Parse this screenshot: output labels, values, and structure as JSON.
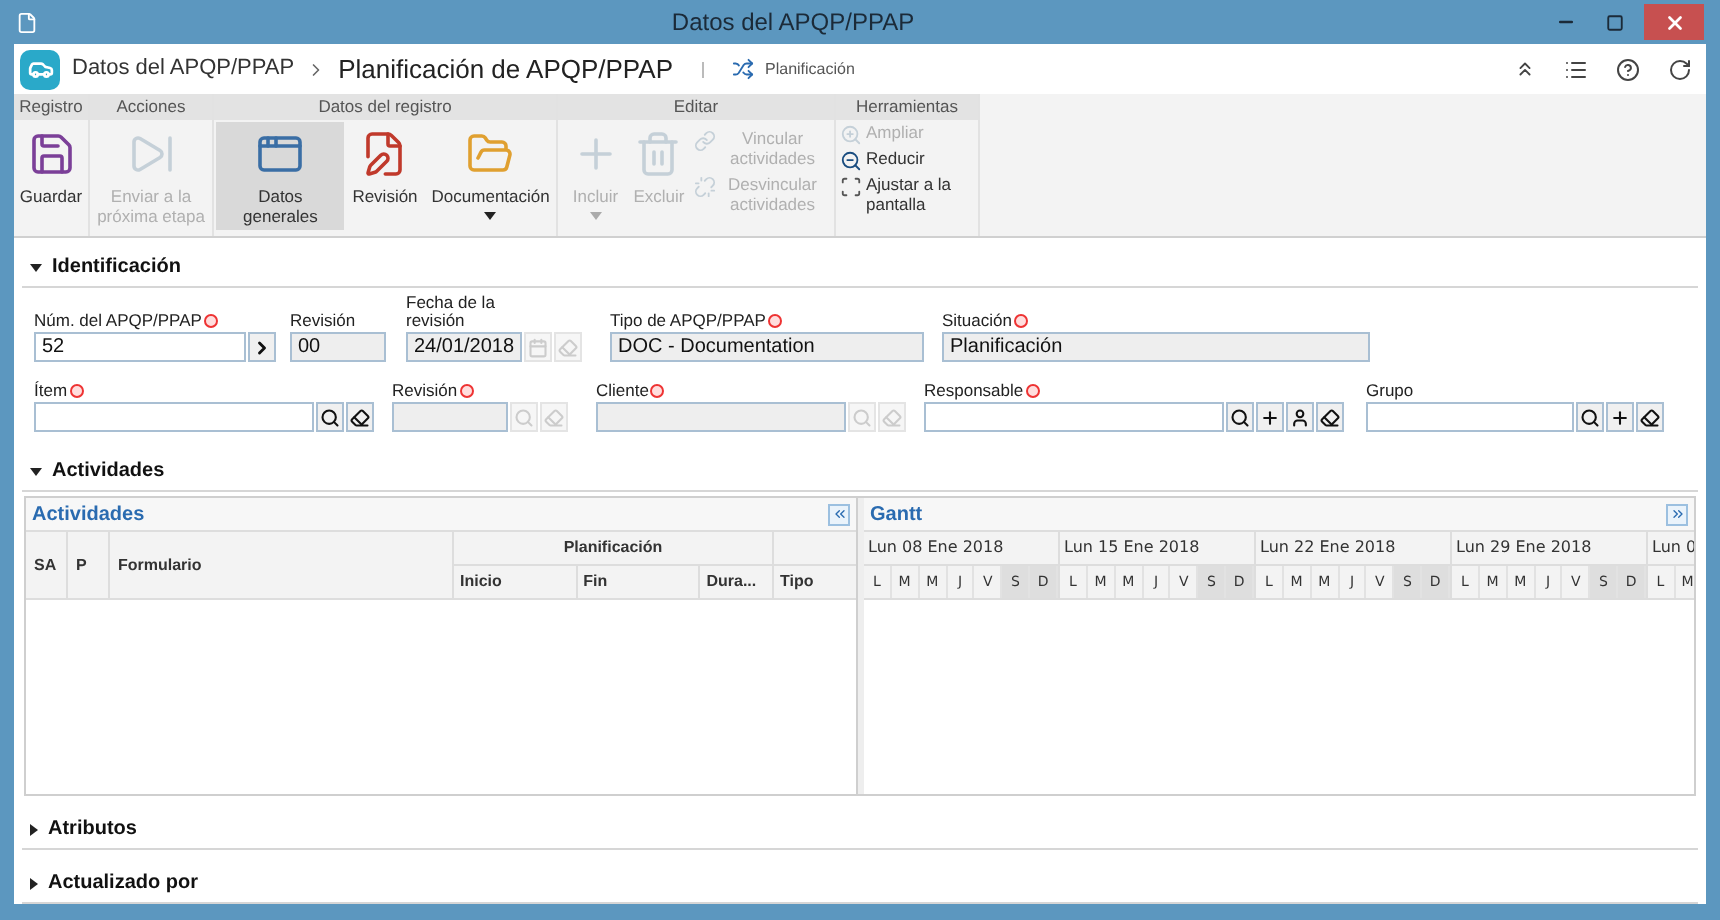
{
  "window": {
    "title": "Datos del APQP/PPAP"
  },
  "header": {
    "breadcrumb": "Datos del APQP/PPAP",
    "title": "Planificación de APQP/PPAP",
    "stage": "Planificación"
  },
  "ribbon": [
    {
      "label": "Registro",
      "items": [
        {
          "kind": "large",
          "label": "Guardar",
          "disabled": false,
          "selected": false,
          "dropdown": false
        }
      ]
    },
    {
      "label": "Acciones",
      "items": [
        {
          "kind": "large",
          "label": "Enviar a la próxima etapa",
          "disabled": true,
          "selected": false,
          "dropdown": false
        }
      ]
    },
    {
      "label": "Datos del registro",
      "items": [
        {
          "kind": "large",
          "label": "Datos generales",
          "disabled": false,
          "selected": true,
          "dropdown": false
        },
        {
          "kind": "large",
          "label": "Revisión",
          "disabled": false,
          "selected": false,
          "dropdown": false
        },
        {
          "kind": "large",
          "label": "Documentación",
          "disabled": false,
          "selected": false,
          "dropdown": true
        }
      ]
    },
    {
      "label": "Editar",
      "items": [
        {
          "kind": "large",
          "label": "Incluir",
          "disabled": true,
          "selected": false,
          "dropdown": true
        },
        {
          "kind": "large",
          "label": "Excluir",
          "disabled": true,
          "selected": false,
          "dropdown": false
        },
        {
          "kind": "small",
          "label": "Vincular actividades",
          "disabled": true,
          "selected": false,
          "dropdown": false
        },
        {
          "kind": "small",
          "label": "Desvincular actividades",
          "disabled": true,
          "selected": false,
          "dropdown": false
        }
      ]
    },
    {
      "label": "Herramientas",
      "items": [
        {
          "kind": "tiny",
          "label": "Ampliar",
          "disabled": true,
          "selected": false,
          "dropdown": false
        },
        {
          "kind": "tiny",
          "label": "Reducir",
          "disabled": false,
          "selected": false,
          "dropdown": false
        },
        {
          "kind": "tiny",
          "label": "Ajustar a la pantalla",
          "disabled": false,
          "selected": false,
          "dropdown": false
        }
      ]
    }
  ],
  "identification": {
    "title": "Identificación",
    "expanded": true,
    "fields": [
      {
        "label": "Núm. del APQP/PPAP",
        "required": true,
        "value": "52",
        "disabled": false
      },
      {
        "label": "Revisión",
        "required": false,
        "value": "00",
        "disabled": true
      },
      {
        "label": "Fecha de la revisión",
        "required": false,
        "value": "24/01/2018",
        "disabled": true
      },
      {
        "label": "Tipo de APQP/PPAP",
        "required": true,
        "value": "DOC - Documentation",
        "disabled": true
      },
      {
        "label": "Situación",
        "required": true,
        "value": "Planificación",
        "disabled": true
      },
      {
        "label": "Ítem",
        "required": true,
        "disabled": false
      },
      {
        "label": "Revisión",
        "required": true,
        "disabled": true
      },
      {
        "label": "Cliente",
        "required": true,
        "disabled": true
      },
      {
        "label": "Responsable",
        "required": true,
        "disabled": false
      },
      {
        "label": "Grupo",
        "required": false,
        "disabled": false
      }
    ]
  },
  "activities": {
    "title": "Actividades",
    "expanded": true,
    "grid": {
      "title": "Actividades",
      "columns": [
        "SA",
        "P",
        "Formulario"
      ],
      "group": "Planificación",
      "subcolumns": [
        "Inicio",
        "Fin",
        "Dura..."
      ],
      "last_column": "Tipo"
    },
    "gantt": {
      "title": "Gantt",
      "weeks": [
        {
          "label": "Lun 08 Ene 2018",
          "days": [
            {
              "label": "L",
              "weekend": false
            },
            {
              "label": "M",
              "weekend": false
            },
            {
              "label": "M",
              "weekend": false
            },
            {
              "label": "J",
              "weekend": false
            },
            {
              "label": "V",
              "weekend": false
            },
            {
              "label": "S",
              "weekend": true
            },
            {
              "label": "D",
              "weekend": true
            }
          ]
        },
        {
          "label": "Lun 15 Ene 2018",
          "days": [
            {
              "label": "L",
              "weekend": false
            },
            {
              "label": "M",
              "weekend": false
            },
            {
              "label": "M",
              "weekend": false
            },
            {
              "label": "J",
              "weekend": false
            },
            {
              "label": "V",
              "weekend": false
            },
            {
              "label": "S",
              "weekend": true
            },
            {
              "label": "D",
              "weekend": true
            }
          ]
        },
        {
          "label": "Lun 22 Ene 2018",
          "days": [
            {
              "label": "L",
              "weekend": false
            },
            {
              "label": "M",
              "weekend": false
            },
            {
              "label": "M",
              "weekend": false
            },
            {
              "label": "J",
              "weekend": false
            },
            {
              "label": "V",
              "weekend": false
            },
            {
              "label": "S",
              "weekend": true
            },
            {
              "label": "D",
              "weekend": true
            }
          ]
        },
        {
          "label": "Lun 29 Ene 2018",
          "days": [
            {
              "label": "L",
              "weekend": false
            },
            {
              "label": "M",
              "weekend": false
            },
            {
              "label": "M",
              "weekend": false
            },
            {
              "label": "J",
              "weekend": false
            },
            {
              "label": "V",
              "weekend": false
            },
            {
              "label": "S",
              "weekend": true
            },
            {
              "label": "D",
              "weekend": true
            }
          ]
        },
        {
          "label": "Lun 0",
          "days": [
            {
              "label": "L",
              "weekend": false
            },
            {
              "label": "M",
              "weekend": false
            }
          ]
        }
      ]
    }
  },
  "sections": [
    {
      "title": "Atributos",
      "expanded": false
    },
    {
      "title": "Actualizado por",
      "expanded": false
    }
  ]
}
